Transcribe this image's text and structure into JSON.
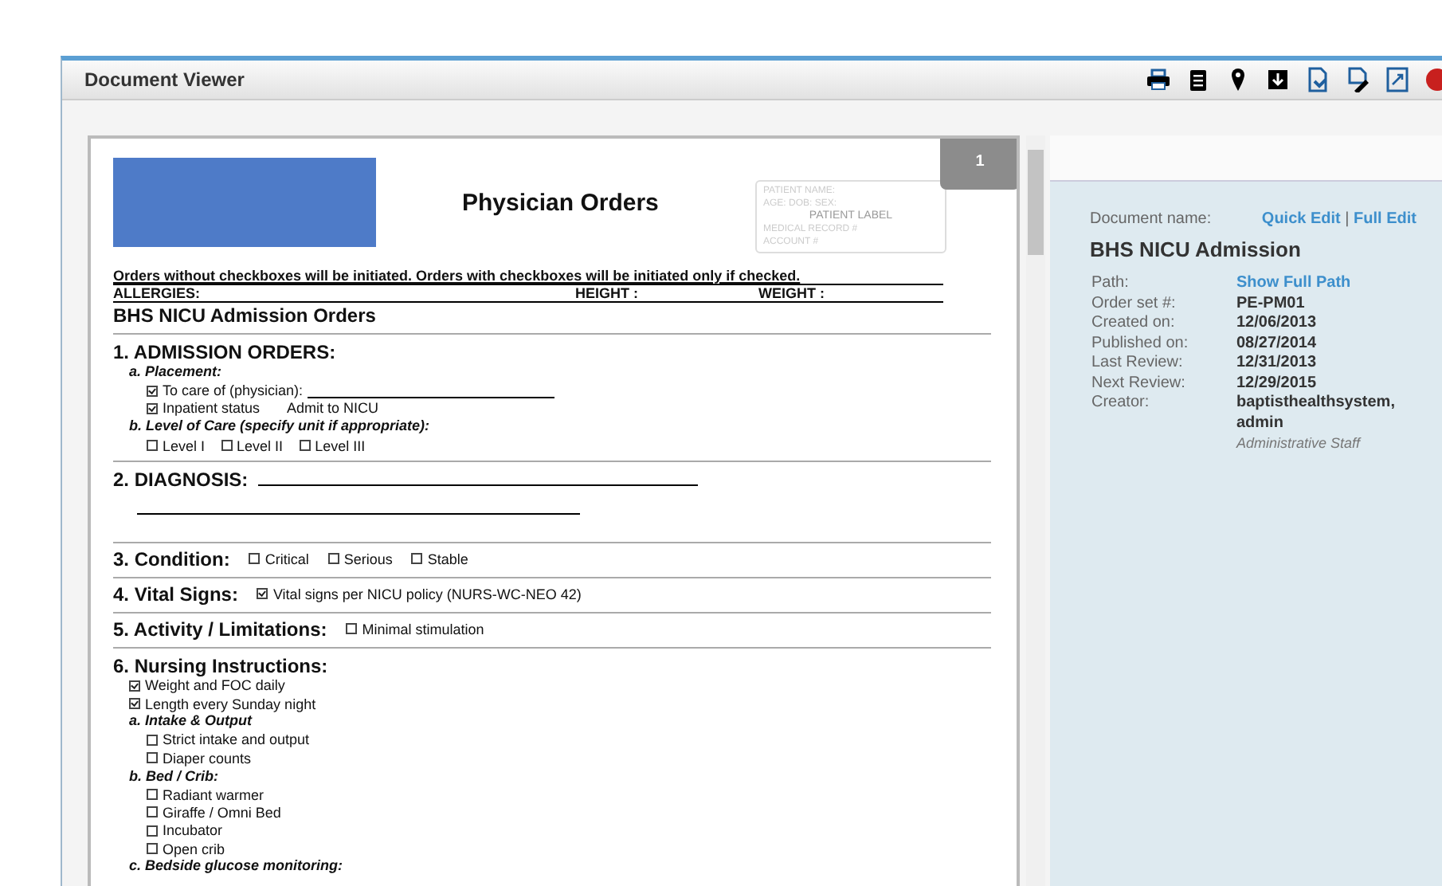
{
  "window": {
    "title": "Document Viewer"
  },
  "document": {
    "page_badge": "1",
    "header_title": "Physician Orders",
    "patient_label": {
      "lines": [
        "PATIENT NAME:",
        "AGE:       DOB:            SEX:"
      ],
      "title": "PATIENT LABEL",
      "lines_after": [
        "MEDICAL RECORD #",
        "ACCOUNT #"
      ]
    },
    "notice": "Orders without checkboxes will be initiated. Orders with checkboxes will be initiated only if checked.",
    "info_fields": [
      "ALLERGIES:",
      "HEIGHT :",
      "WEIGHT :"
    ],
    "title": "BHS NICU Admission Orders",
    "sections": [
      {
        "heading": "1. ADMISSION ORDERS:",
        "kind": "block",
        "items": [
          {
            "kind": "sub",
            "label": "a. Placement:",
            "children": [
              {
                "kind": "field",
                "label": "To care of (physician):",
                "checked": true
              },
              {
                "kind": "check",
                "label": "Inpatient status",
                "note": "Admit to NICU",
                "checked": true
              }
            ]
          },
          {
            "kind": "sub",
            "label": "b. Level of Care (specify unit if appropriate):",
            "children": [
              {
                "kind": "row",
                "options": [
                  {
                    "label": "Level I",
                    "checked": false
                  },
                  {
                    "label": "Level II",
                    "checked": false
                  },
                  {
                    "label": "Level III",
                    "checked": false
                  }
                ]
              }
            ]
          }
        ]
      },
      {
        "heading": "2. DIAGNOSIS:",
        "kind": "lines"
      },
      {
        "heading": "3. Condition:",
        "kind": "inline",
        "options": [
          {
            "label": "Critical",
            "checked": false
          },
          {
            "label": "Serious",
            "checked": false
          },
          {
            "label": "Stable",
            "checked": false
          }
        ]
      },
      {
        "heading": "4. Vital Signs:",
        "kind": "inline",
        "options": [
          {
            "label": "Vital signs per NICU policy (NURS-WC-NEO 42)",
            "checked": true
          }
        ]
      },
      {
        "heading": "5. Activity / Limitations:",
        "kind": "inline",
        "options": [
          {
            "label": "Minimal stimulation",
            "checked": false
          }
        ]
      },
      {
        "heading": "6. Nursing Instructions:",
        "kind": "block",
        "items": [
          {
            "kind": "check",
            "label": "Weight and FOC daily",
            "checked": true
          },
          {
            "kind": "check",
            "label": "Length every Sunday night",
            "checked": true
          },
          {
            "kind": "sub",
            "label": "a. Intake & Output",
            "children": [
              {
                "kind": "check",
                "label": "Strict intake and output",
                "checked": false
              },
              {
                "kind": "check",
                "label": "Diaper counts",
                "checked": false
              }
            ]
          },
          {
            "kind": "sub",
            "label": "b. Bed / Crib:",
            "children": [
              {
                "kind": "check",
                "label": "Radiant warmer",
                "checked": false
              },
              {
                "kind": "check",
                "label": "Giraffe / Omni Bed",
                "checked": false
              },
              {
                "kind": "check",
                "label": "Incubator",
                "checked": false
              },
              {
                "kind": "check",
                "label": "Open crib",
                "checked": false
              }
            ]
          },
          {
            "kind": "sub",
            "label": "c. Bedside glucose monitoring:"
          }
        ]
      }
    ]
  },
  "details": {
    "name_label": "Document name:",
    "links": [
      "Quick Edit",
      "Full Edit"
    ],
    "link_separator": "|",
    "name": "BHS NICU Admission",
    "rows": [
      {
        "label": "Path:",
        "value": "Show Full Path",
        "kind": "link"
      },
      {
        "label": "Order set #:",
        "value": "PE-PM01",
        "kind": "text"
      },
      {
        "label": "Created on:",
        "value": "12/06/2013",
        "kind": "text"
      },
      {
        "label": "Published on:",
        "value": "08/27/2014",
        "kind": "text"
      },
      {
        "label": "Last Review:",
        "value": "12/31/2013",
        "kind": "text"
      },
      {
        "label": "Next Review:",
        "value": "12/29/2015",
        "kind": "text"
      },
      {
        "label": "Creator:",
        "value": "baptisthealthsystem, admin",
        "sub": "Administrative Staff",
        "kind": "text"
      }
    ]
  }
}
